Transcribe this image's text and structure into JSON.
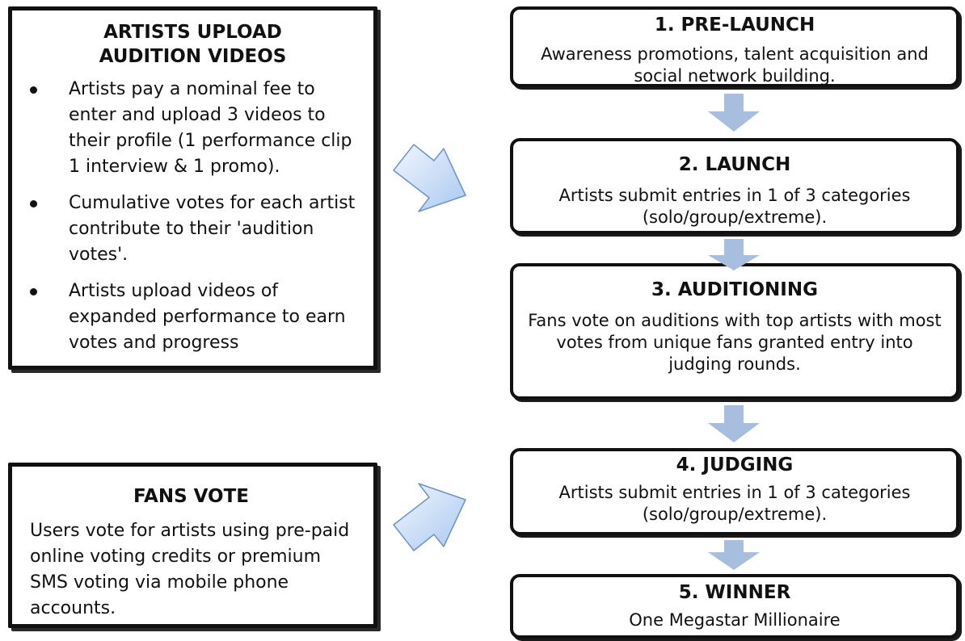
{
  "artists_box": {
    "title": "ARTISTS UPLOAD\nAUDITION VIDEOS",
    "bullets": [
      "Artists pay a nominal fee to enter and upload 3 videos to their profile (1 performance clip 1 interview & 1 promo).",
      "Cumulative votes for each artist contribute to their 'audition votes'.",
      "Artists upload videos of expanded performance to earn votes and progress"
    ]
  },
  "fans_box": {
    "title": "FANS VOTE",
    "text": "Users vote for artists using pre-paid online voting credits or premium SMS voting via mobile phone accounts."
  },
  "steps": [
    {
      "title": "1. PRE-LAUNCH",
      "desc": "Awareness promotions, talent acquisition and social network building."
    },
    {
      "title": "2. LAUNCH",
      "desc": "Artists submit entries in 1 of 3 categories (solo/group/extreme)."
    },
    {
      "title": "3. AUDITIONING",
      "desc": "Fans vote on auditions with top artists with most votes from unique fans granted entry into judging rounds."
    },
    {
      "title": "4. JUDGING",
      "desc": "Artists submit entries in 1 of 3 categories (solo/group/extreme)."
    },
    {
      "title": "5. WINNER",
      "desc": "One Megastar Millionaire"
    }
  ],
  "colors": {
    "down_arrow": "#a8bedf",
    "side_arrow_fill_light": "#f2f7fe",
    "side_arrow_fill_dark": "#a9c8ef",
    "side_arrow_stroke": "#6e93c7"
  }
}
